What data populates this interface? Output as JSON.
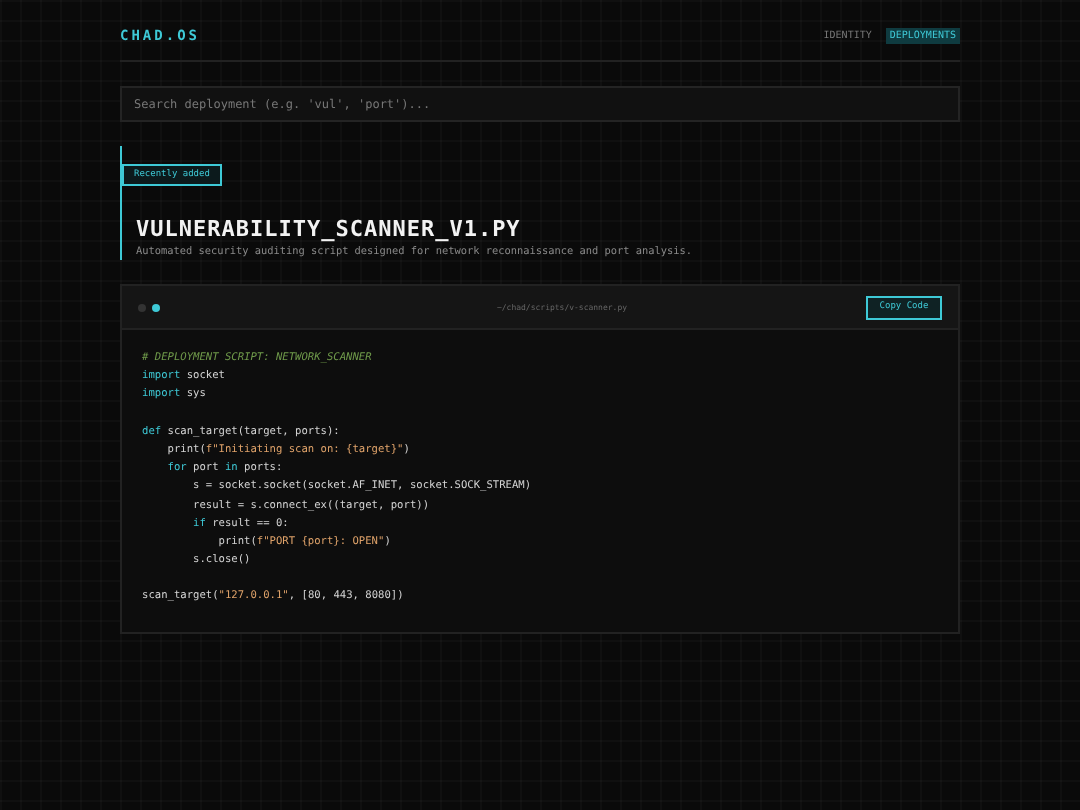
{
  "brand": "CHAD.OS",
  "nav": [
    {
      "label": "IDENTITY",
      "selected": false
    },
    {
      "label": "DEPLOYMENTS",
      "selected": true
    }
  ],
  "search": {
    "placeholder": "Search deployment (e.g. 'vul', 'port')..."
  },
  "badge": "Recently added",
  "title": "VULNERABILITY_SCANNER_V1.PY",
  "description": "Automated security auditing script designed for network reconnaissance and port analysis.",
  "code_panel": {
    "path": "~/chad/scripts/v-scanner.py",
    "copy_button": "Copy Code",
    "lines": [
      {
        "kind": "code",
        "tokens": [
          {
            "kind": "comment",
            "text": "# DEPLOYMENT SCRIPT: NETWORK_SCANNER"
          }
        ]
      },
      {
        "kind": "code",
        "tokens": [
          {
            "kind": "keyword",
            "text": "import"
          },
          {
            "kind": "plain",
            "text": " socket"
          }
        ]
      },
      {
        "kind": "code",
        "tokens": [
          {
            "kind": "keyword",
            "text": "import"
          },
          {
            "kind": "plain",
            "text": " sys"
          }
        ]
      },
      {
        "kind": "blank"
      },
      {
        "kind": "code",
        "tokens": [
          {
            "kind": "keyword",
            "text": "def"
          },
          {
            "kind": "plain",
            "text": " scan_target(target, ports):"
          }
        ]
      },
      {
        "kind": "code",
        "tokens": [
          {
            "kind": "plain",
            "text": "    print("
          },
          {
            "kind": "string",
            "text": "f\"Initiating scan on: {target}\""
          },
          {
            "kind": "plain",
            "text": ")"
          }
        ]
      },
      {
        "kind": "code",
        "tokens": [
          {
            "kind": "keyword",
            "text": "    for"
          },
          {
            "kind": "plain",
            "text": " port "
          },
          {
            "kind": "keyword",
            "text": "in"
          },
          {
            "kind": "plain",
            "text": " ports:"
          }
        ]
      },
      {
        "kind": "code",
        "tokens": [
          {
            "kind": "plain",
            "text": "        s = socket.socket(socket.AF_INET, socket.SOCK_STREAM)"
          }
        ]
      },
      {
        "kind": "code",
        "tokens": [
          {
            "kind": "plain",
            "text": "        result = s.connect_ex((target, port))"
          }
        ]
      },
      {
        "kind": "code",
        "tokens": [
          {
            "kind": "keyword",
            "text": "        if"
          },
          {
            "kind": "plain",
            "text": " result == 0:"
          }
        ]
      },
      {
        "kind": "code",
        "tokens": [
          {
            "kind": "plain",
            "text": "            print("
          },
          {
            "kind": "string",
            "text": "f\"PORT {port}: OPEN\""
          },
          {
            "kind": "plain",
            "text": ")"
          }
        ]
      },
      {
        "kind": "code",
        "tokens": [
          {
            "kind": "plain",
            "text": "        s.close()"
          }
        ]
      },
      {
        "kind": "blank"
      },
      {
        "kind": "code",
        "tokens": [
          {
            "kind": "plain",
            "text": "scan_target("
          },
          {
            "kind": "string",
            "text": "\"127.0.0.1\""
          },
          {
            "kind": "plain",
            "text": ", [80, 443, 8080])"
          }
        ]
      }
    ]
  }
}
